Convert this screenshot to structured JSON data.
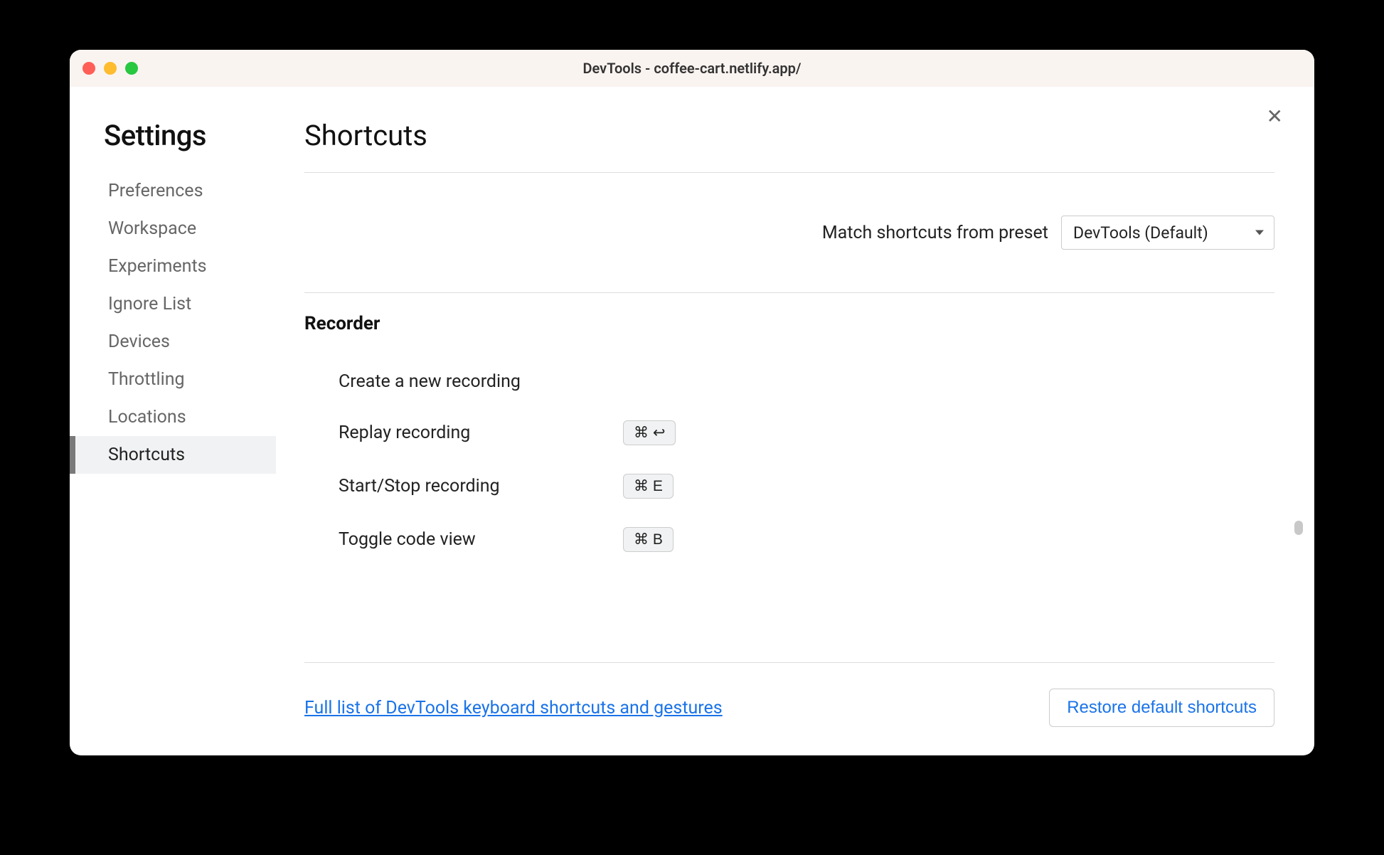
{
  "window": {
    "title": "DevTools - coffee-cart.netlify.app/"
  },
  "sidebar": {
    "title": "Settings",
    "items": [
      {
        "label": "Preferences"
      },
      {
        "label": "Workspace"
      },
      {
        "label": "Experiments"
      },
      {
        "label": "Ignore List"
      },
      {
        "label": "Devices"
      },
      {
        "label": "Throttling"
      },
      {
        "label": "Locations"
      },
      {
        "label": "Shortcuts"
      }
    ]
  },
  "main": {
    "title": "Shortcuts",
    "preset_label": "Match shortcuts from preset",
    "preset_value": "DevTools (Default)",
    "section_title": "Recorder",
    "shortcuts": [
      {
        "label": "Create a new recording",
        "keys": ""
      },
      {
        "label": "Replay recording",
        "keys": "⌘  ↩"
      },
      {
        "label": "Start/Stop recording",
        "keys": "⌘  E"
      },
      {
        "label": "Toggle code view",
        "keys": "⌘  B"
      }
    ],
    "footer_link": "Full list of DevTools keyboard shortcuts and gestures",
    "restore_label": "Restore default shortcuts"
  }
}
